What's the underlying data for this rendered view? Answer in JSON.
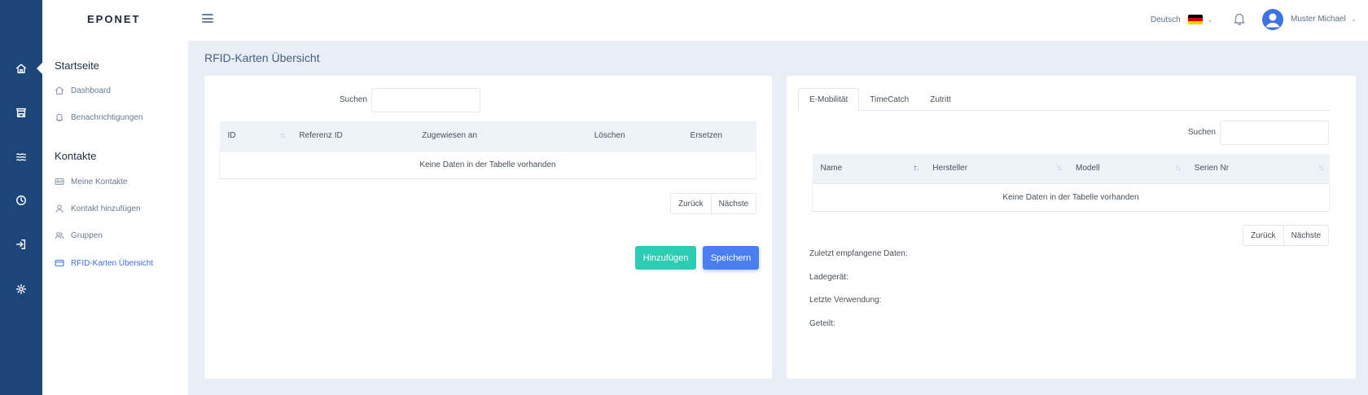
{
  "app": {
    "logo": "EPONET"
  },
  "rail": {
    "icons": [
      "home-icon",
      "storefront-icon",
      "waves-icon",
      "clock-icon",
      "login-icon",
      "settings-icon"
    ]
  },
  "sidebar": {
    "section_start": "Startseite",
    "items_start": [
      {
        "label": "Dashboard",
        "icon": "home-icon"
      },
      {
        "label": "Benachrichtigungen",
        "icon": "bell-icon"
      }
    ],
    "section_contacts": "Kontakte",
    "items_contacts": [
      {
        "label": "Meine Kontakte",
        "icon": "id-card-icon"
      },
      {
        "label": "Kontakt hinzufügen",
        "icon": "user-icon"
      },
      {
        "label": "Gruppen",
        "icon": "users-icon"
      },
      {
        "label": "RFID-Karten Übersicht",
        "icon": "credit-card-icon",
        "active": true
      }
    ]
  },
  "header": {
    "language": "Deutsch",
    "user_name": "Muster Michael"
  },
  "page": {
    "title": "RFID-Karten Übersicht"
  },
  "left_panel": {
    "search_label": "Suchen",
    "search_value": "",
    "table": {
      "columns": [
        "ID",
        "Referenz ID",
        "Zugewiesen an",
        "Löschen",
        "Ersetzen"
      ],
      "empty_text": "Keine Daten in der Tabelle vorhanden"
    },
    "pager": {
      "prev": "Zurück",
      "next": "Nächste"
    },
    "add_label": "Hinzufügen",
    "save_label": "Speichern"
  },
  "right_panel": {
    "tabs": [
      {
        "label": "E-Mobilität",
        "active": true
      },
      {
        "label": "TimeCatch"
      },
      {
        "label": "Zutritt"
      }
    ],
    "search_label": "Suchen",
    "search_value": "",
    "table": {
      "columns": [
        "Name",
        "Hersteller",
        "Modell",
        "Serien Nr"
      ],
      "empty_text": "Keine Daten in der Tabelle vorhanden"
    },
    "pager": {
      "prev": "Zurück",
      "next": "Nächste"
    },
    "info": {
      "last_data": "Zuletzt empfangene Daten:",
      "charger": "Ladegerät:",
      "last_use": "Letzte Verwendung:",
      "shared": "Geteilt:"
    }
  },
  "colors": {
    "rail": "#1c4679",
    "accent": "#4a7ef0",
    "teal": "#2ccbb4",
    "background": "#e9eef6"
  }
}
